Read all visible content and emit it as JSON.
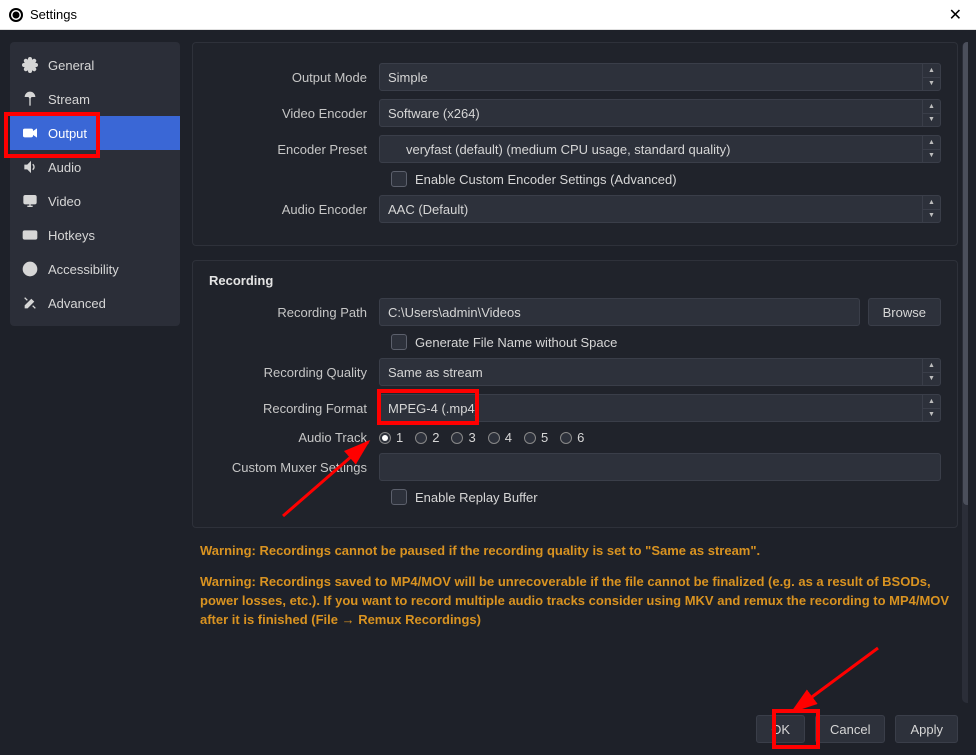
{
  "titlebar": {
    "title": "Settings"
  },
  "sidebar": {
    "items": [
      {
        "label": "General"
      },
      {
        "label": "Stream"
      },
      {
        "label": "Output"
      },
      {
        "label": "Audio"
      },
      {
        "label": "Video"
      },
      {
        "label": "Hotkeys"
      },
      {
        "label": "Accessibility"
      },
      {
        "label": "Advanced"
      }
    ]
  },
  "output": {
    "mode_label": "Output Mode",
    "mode_value": "Simple",
    "video_enc_label": "Video Encoder",
    "video_enc_value": "Software (x264)",
    "preset_label": "Encoder Preset",
    "preset_value": "veryfast (default) (medium CPU usage, standard quality)",
    "enable_custom_label": "Enable Custom Encoder Settings (Advanced)",
    "audio_enc_label": "Audio Encoder",
    "audio_enc_value": "AAC (Default)"
  },
  "recording": {
    "heading": "Recording",
    "path_label": "Recording Path",
    "path_value": "C:\\Users\\admin\\Videos",
    "browse_label": "Browse",
    "gen_filename_label": "Generate File Name without Space",
    "quality_label": "Recording Quality",
    "quality_value": "Same as stream",
    "format_label": "Recording Format",
    "format_value": "MPEG-4 (.mp4)",
    "audio_track_label": "Audio Track",
    "tracks": [
      "1",
      "2",
      "3",
      "4",
      "5",
      "6"
    ],
    "muxer_label": "Custom Muxer Settings",
    "muxer_value": "",
    "replay_buffer_label": "Enable Replay Buffer"
  },
  "warnings": {
    "w1": "Warning: Recordings cannot be paused if the recording quality is set to \"Same as stream\".",
    "w2": "Warning: Recordings saved to MP4/MOV will be unrecoverable if the file cannot be finalized (e.g. as a result of BSODs, power losses, etc.). If you want to record multiple audio tracks consider using MKV and remux the recording to MP4/MOV after it is finished (File → Remux Recordings)"
  },
  "footer": {
    "ok": "OK",
    "cancel": "Cancel",
    "apply": "Apply"
  }
}
